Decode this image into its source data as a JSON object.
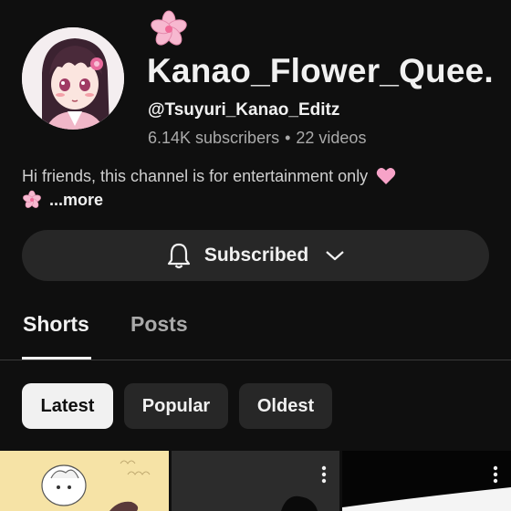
{
  "channel": {
    "name": "Kanao_Flower_Quee...",
    "handle": "@Tsuyuri_Kanao_Editz",
    "subscribers": "6.14K subscribers",
    "separator": "•",
    "videos": "22 videos",
    "description": "Hi friends, this channel is for entertainment only",
    "more_label": "...more"
  },
  "subscribe": {
    "label": "Subscribed"
  },
  "tabs": [
    {
      "label": "Shorts",
      "active": true
    },
    {
      "label": "Posts",
      "active": false
    }
  ],
  "filters": [
    {
      "label": "Latest",
      "active": true
    },
    {
      "label": "Popular",
      "active": false
    },
    {
      "label": "Oldest",
      "active": false
    }
  ],
  "colors": {
    "background": "#0f0f0f",
    "button": "#272727",
    "text": "#f1f1f1",
    "muted": "#aaaaaa",
    "heart": "#f7a3c8",
    "flower": "#f7b8d0"
  },
  "icons": [
    "cherry-blossom-icon",
    "heart-icon",
    "bell-icon",
    "chevron-down-icon",
    "more-vert-icon"
  ]
}
